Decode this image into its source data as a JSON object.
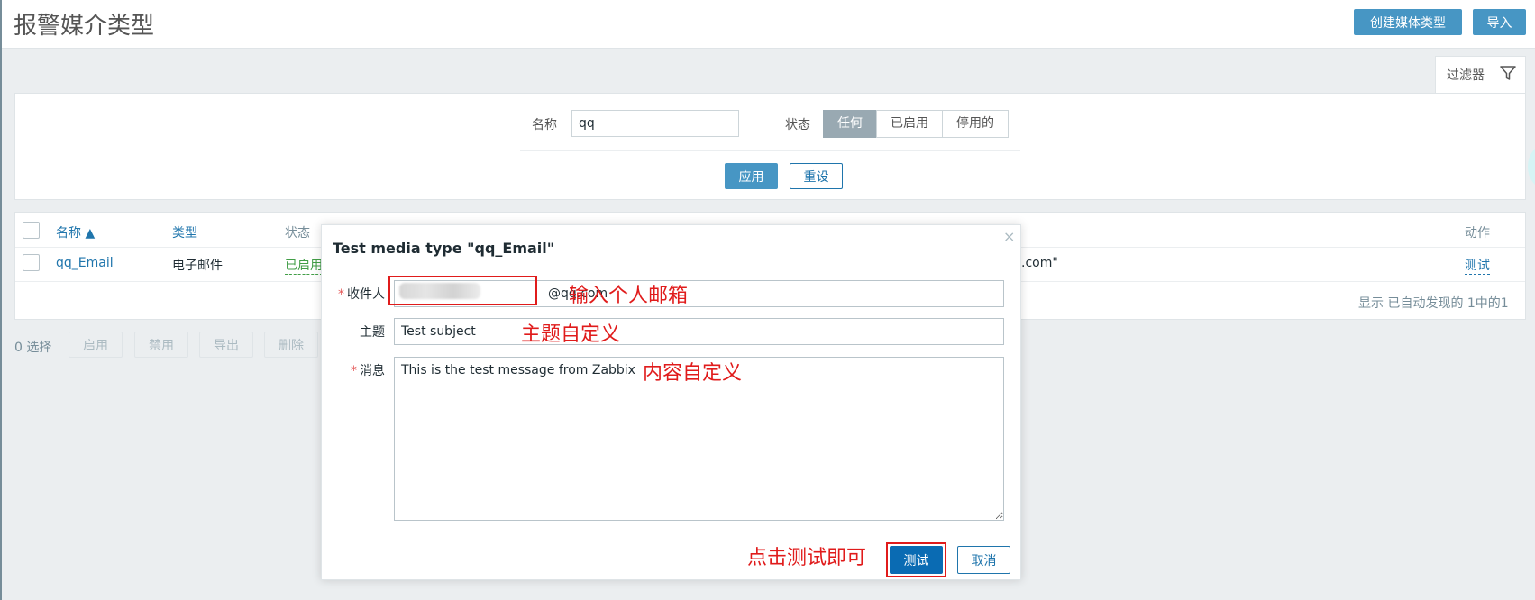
{
  "header": {
    "title": "报警媒介类型",
    "create_button": "创建媒体类型",
    "import_button": "导入"
  },
  "filter": {
    "tab_label": "过滤器",
    "name_label": "名称",
    "name_value": "qq",
    "status_label": "状态",
    "status_options": [
      "任何",
      "已启用",
      "停用的"
    ],
    "status_selected": "任何",
    "apply_button": "应用",
    "reset_button": "重设"
  },
  "table": {
    "columns": [
      "名称 ▲",
      "类型",
      "状态",
      "动作"
    ],
    "row": {
      "name": "qq_Email",
      "type": "电子邮件",
      "status": "已启用",
      "details_tail": ".com\"",
      "action": "测试"
    },
    "footer": "显示 已自动发现的 1中的1"
  },
  "mass_actions": {
    "selected_count": "0 选择",
    "buttons": [
      "启用",
      "禁用",
      "导出",
      "删除"
    ]
  },
  "dialog": {
    "title": "Test media type \"qq_Email\"",
    "close_glyph": "×",
    "required_mark": "*",
    "recipient_label": "收件人",
    "recipient_value": "@qq.com",
    "subject_label": "主题",
    "subject_value": "Test subject",
    "message_label": "消息",
    "message_value": "This is the test message from Zabbix",
    "test_button": "测试",
    "cancel_button": "取消"
  },
  "annotations": {
    "recipient_note": "输入个人邮箱",
    "subject_note": "主题自定义",
    "message_note": "内容自定义",
    "test_note": "点击测试即可"
  },
  "colors": {
    "primary": "#4796c4",
    "link": "#1f75ac",
    "enabled": "#429e47",
    "annotation": "#e01b1b"
  }
}
